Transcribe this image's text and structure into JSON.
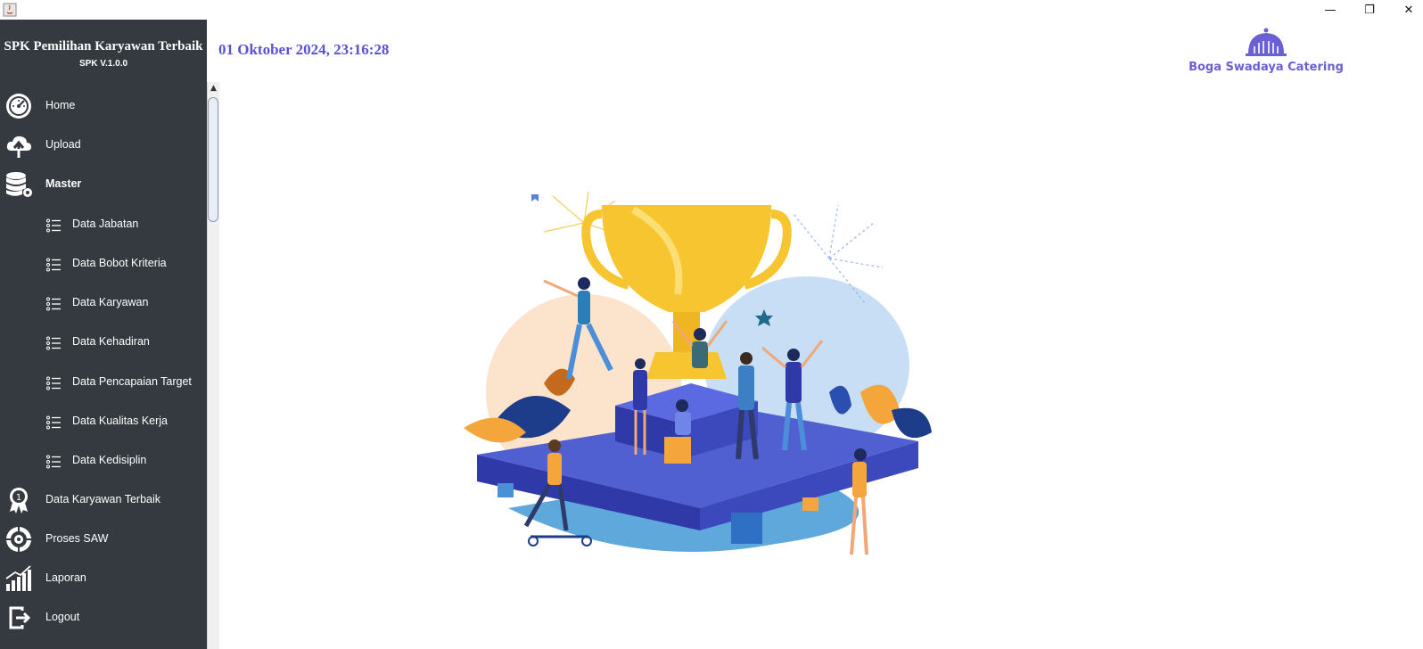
{
  "window": {
    "controls": {
      "minimize": "—",
      "maximize": "❐",
      "close": "✕"
    }
  },
  "sidebar": {
    "brand_title": "SPK Pemilihan Karyawan Terbaik",
    "brand_version": "SPK V.1.0.0",
    "items": [
      {
        "label": "Home",
        "icon": "speedometer-icon"
      },
      {
        "label": "Upload",
        "icon": "cloud-upload-icon"
      },
      {
        "label": "Master",
        "icon": "database-gear-icon"
      },
      {
        "label": "Data Jabatan",
        "icon": "list-icon"
      },
      {
        "label": "Data Bobot Kriteria",
        "icon": "list-icon"
      },
      {
        "label": "Data Karyawan",
        "icon": "list-icon"
      },
      {
        "label": "Data Kehadiran",
        "icon": "list-icon"
      },
      {
        "label": "Data Pencapaian Target",
        "icon": "list-icon"
      },
      {
        "label": "Data Kualitas Kerja",
        "icon": "list-icon"
      },
      {
        "label": "Data Kedisiplin",
        "icon": "list-icon"
      },
      {
        "label": "Data Karyawan Terbaik",
        "icon": "award-medal-icon"
      },
      {
        "label": "Proses SAW",
        "icon": "process-cycle-icon"
      },
      {
        "label": "Laporan",
        "icon": "bar-chart-icon"
      },
      {
        "label": "Logout",
        "icon": "logout-icon"
      }
    ]
  },
  "header": {
    "datetime": "01 Oktober 2024, 23:16:28",
    "logo_text": "Boga Swadaya Catering"
  },
  "colors": {
    "sidebar_bg": "#343a40",
    "accent": "#5a52d6",
    "logo": "#6b5fd6"
  }
}
